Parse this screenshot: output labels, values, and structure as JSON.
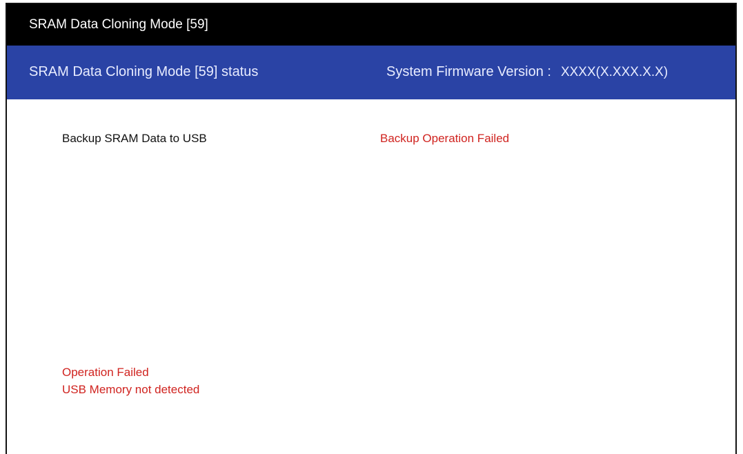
{
  "title_bar": {
    "title": "SRAM Data Cloning Mode [59]"
  },
  "status_bar": {
    "label": "SRAM Data Cloning Mode [59] status",
    "firmware_label": "System Firmware Version :",
    "firmware_value": "XXXX(X.XXX.X.X)"
  },
  "content": {
    "item_label": "Backup SRAM Data to USB",
    "item_status": "Backup Operation Failed",
    "messages": [
      "Operation Failed",
      "USB Memory not detected"
    ]
  },
  "colors": {
    "title_bar_bg": "#000000",
    "status_bar_bg": "#2a43a5",
    "error_text": "#d0231f"
  }
}
